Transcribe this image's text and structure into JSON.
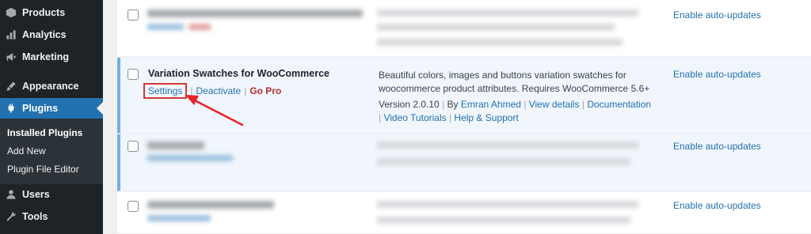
{
  "sidebar": {
    "items": [
      {
        "label": "Products",
        "icon": "products-icon"
      },
      {
        "label": "Analytics",
        "icon": "analytics-icon"
      },
      {
        "label": "Marketing",
        "icon": "marketing-icon"
      },
      {
        "label": "Appearance",
        "icon": "appearance-icon"
      },
      {
        "label": "Plugins",
        "icon": "plugins-icon",
        "active": true
      },
      {
        "label": "Users",
        "icon": "users-icon"
      },
      {
        "label": "Tools",
        "icon": "tools-icon"
      }
    ],
    "submenu": [
      {
        "label": "Installed Plugins",
        "current": true
      },
      {
        "label": "Add New"
      },
      {
        "label": "Plugin File Editor"
      }
    ]
  },
  "plugins": {
    "auto_update_label": "Enable auto-updates",
    "featured": {
      "name": "Variation Swatches for WooCommerce",
      "actions": {
        "settings": "Settings",
        "deactivate": "Deactivate",
        "go_pro": "Go Pro",
        "separator": "|"
      },
      "description": "Beautiful colors, images and buttons variation swatches for woocommerce product attributes. Requires WooCommerce 5.6+",
      "version": "Version 2.0.10",
      "by_prefix": "By",
      "author": "Emran Ahmed",
      "view_details": "View details",
      "documentation": "Documentation",
      "video_tutorials": "Video Tutorials",
      "help_support": "Help & Support"
    }
  },
  "colors": {
    "sidebar_bg": "#1d2327",
    "active_menu": "#2271b1",
    "link": "#2271b1",
    "go_pro": "#b32d2e",
    "highlight_box": "#d63638",
    "annotation_arrow": "#e8222a"
  }
}
